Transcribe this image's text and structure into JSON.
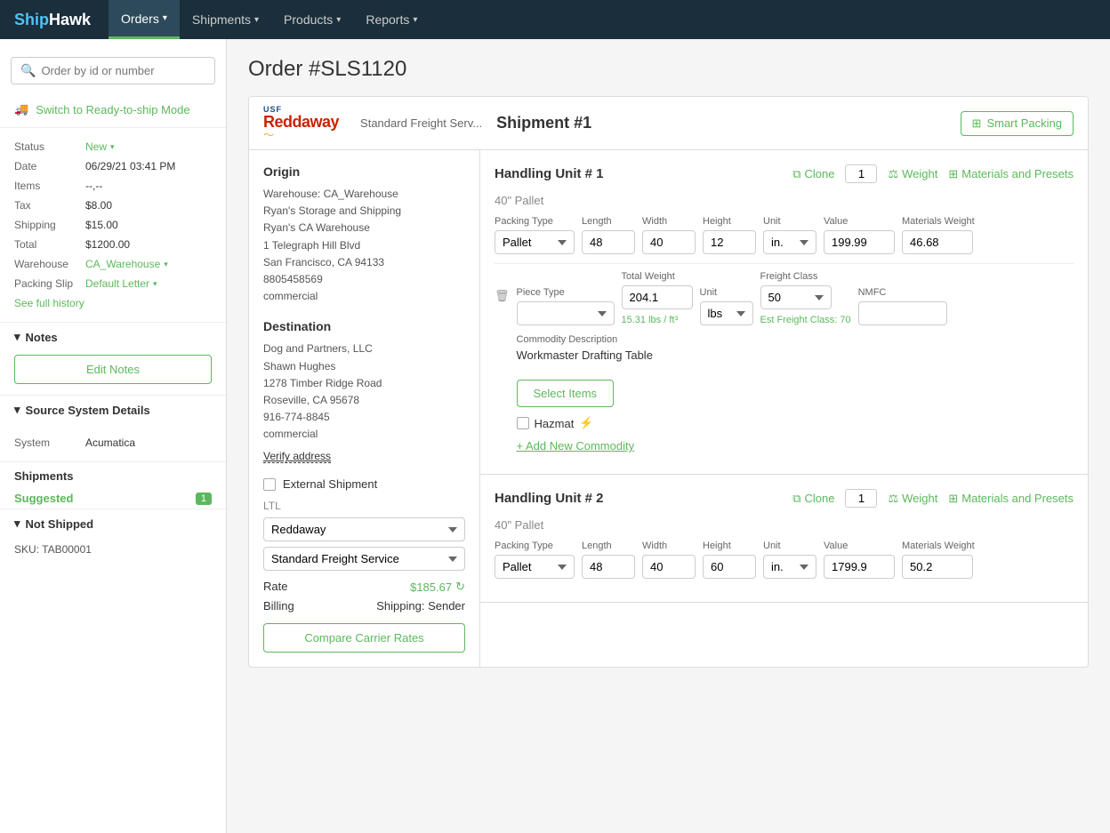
{
  "nav": {
    "logo": "ShipHawk",
    "items": [
      {
        "label": "Orders",
        "active": true
      },
      {
        "label": "Shipments",
        "active": false
      },
      {
        "label": "Products",
        "active": false
      },
      {
        "label": "Reports",
        "active": false
      }
    ]
  },
  "sidebar": {
    "search_placeholder": "Order by id or number",
    "ready_ship": "Switch to Ready-to-ship Mode",
    "status_label": "Status",
    "status_value": "New",
    "date_label": "Date",
    "date_value": "06/29/21 03:41 PM",
    "items_label": "Items",
    "items_value": "--,--",
    "tax_label": "Tax",
    "tax_value": "$8.00",
    "shipping_label": "Shipping",
    "shipping_value": "$15.00",
    "total_label": "Total",
    "total_value": "$1200.00",
    "warehouse_label": "Warehouse",
    "warehouse_value": "CA_Warehouse",
    "packing_label": "Packing Slip",
    "packing_value": "Default Letter",
    "full_history": "See full history",
    "notes_header": "Notes",
    "edit_notes_btn": "Edit Notes",
    "source_header": "Source System Details",
    "system_label": "System",
    "system_value": "Acumatica",
    "shipments_header": "Shipments",
    "suggested_label": "Suggested",
    "suggested_count": "1",
    "not_shipped_header": "Not Shipped",
    "sku_label": "SKU: TAB00001"
  },
  "order": {
    "title": "Order #SLS1120"
  },
  "shipment": {
    "carrier_usf": "USF",
    "carrier_name": "Reddaway",
    "service": "Standard Freight Serv...",
    "shipment_num": "Shipment #1",
    "smart_packing": "Smart Packing"
  },
  "origin": {
    "title": "Origin",
    "warehouse": "Warehouse: CA_Warehouse",
    "company": "Ryan's Storage and Shipping",
    "name": "Ryan's CA Warehouse",
    "address1": "1 Telegraph Hill Blvd",
    "city_state": "San Francisco, CA 94133",
    "phone": "8805458569",
    "type": "commercial"
  },
  "destination": {
    "title": "Destination",
    "company": "Dog and Partners, LLC",
    "name": "Shawn Hughes",
    "address1": "1278 Timber Ridge Road",
    "city_state": "Roseville, CA 95678",
    "phone": "916-774-8845",
    "type": "commercial",
    "verify": "Verify address"
  },
  "ltl": {
    "ext_shipment_label": "External Shipment",
    "ltl_label": "LTL",
    "carrier": "Reddaway",
    "service": "Standard Freight Service",
    "rate_label": "Rate",
    "rate_value": "$185.67",
    "billing_label": "Billing",
    "billing_value": "Shipping: Sender",
    "compare_btn": "Compare Carrier Rates"
  },
  "handling_unit_1": {
    "title": "Handling Unit # 1",
    "clone_label": "Clone",
    "count": "1",
    "weight_label": "Weight",
    "materials_label": "Materials and Presets",
    "pallet_label": "40\" Pallet",
    "packing_type_label": "Packing Type",
    "packing_type": "Pallet",
    "length_label": "Length",
    "length": "48",
    "width_label": "Width",
    "width": "40",
    "height_label": "Height",
    "height": "12",
    "unit_label": "Unit",
    "unit": "in.",
    "value_label": "Value",
    "value": "199.99",
    "materials_weight_label": "Materials Weight",
    "materials_weight": "46.68",
    "piece_type_label": "Piece Type",
    "piece_type": "",
    "total_weight_label": "Total Weight",
    "total_weight": "204.1",
    "weight_density": "15.31 lbs / ft³",
    "unit2_label": "Unit",
    "unit2": "lbs",
    "freight_class_label": "Freight Class",
    "freight_class": "50",
    "nmfc_label": "NMFC",
    "nmfc": "",
    "est_freight": "Est Freight Class: 70",
    "commodity_desc_label": "Commodity Description",
    "commodity_desc": "Workmaster Drafting Table",
    "select_items_btn": "Select Items",
    "hazmat_label": "Hazmat",
    "add_commodity": "+ Add New Commodity"
  },
  "handling_unit_2": {
    "title": "Handling Unit # 2",
    "clone_label": "Clone",
    "count": "1",
    "weight_label": "Weight",
    "materials_label": "Materials and Presets",
    "pallet_label": "40\" Pallet",
    "packing_type_label": "Packing Type",
    "packing_type": "Pallet",
    "length_label": "Length",
    "length": "48",
    "width_label": "Width",
    "width": "40",
    "height_label": "Height",
    "height": "60",
    "unit_label": "Unit",
    "unit": "in.",
    "value_label": "Value",
    "value": "1799.9",
    "materials_weight_label": "Materials Weight",
    "materials_weight": "50.2"
  }
}
